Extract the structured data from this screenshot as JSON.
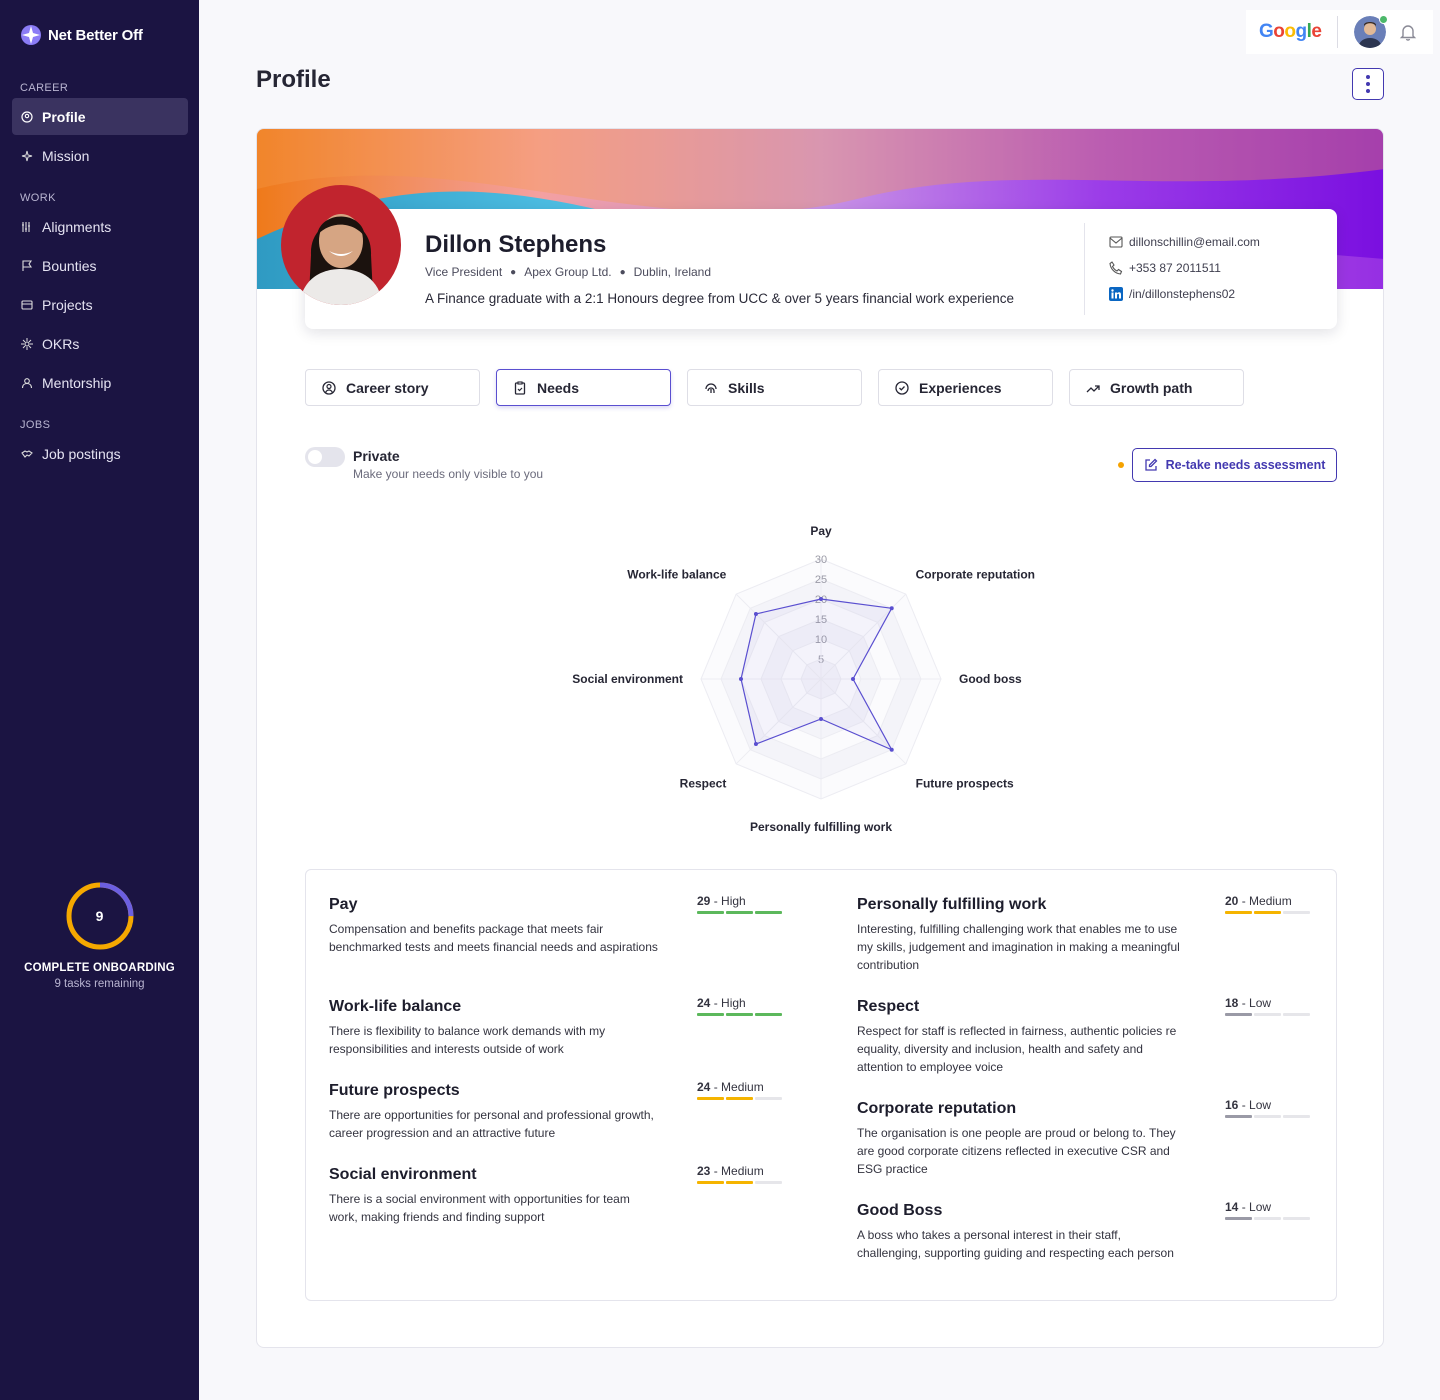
{
  "brand": {
    "name": "Net Better Off"
  },
  "sidebar": {
    "sections": [
      {
        "label": "CAREER",
        "items": [
          {
            "label": "Profile",
            "icon": "profile-icon",
            "active": true
          },
          {
            "label": "Mission",
            "icon": "mission-icon"
          }
        ]
      },
      {
        "label": "WORK",
        "items": [
          {
            "label": "Alignments",
            "icon": "alignments-icon"
          },
          {
            "label": "Bounties",
            "icon": "flag-icon"
          },
          {
            "label": "Projects",
            "icon": "projects-icon"
          },
          {
            "label": "OKRs",
            "icon": "okrs-icon"
          },
          {
            "label": "Mentorship",
            "icon": "mentorship-icon"
          }
        ]
      },
      {
        "label": "JOBS",
        "items": [
          {
            "label": "Job postings",
            "icon": "handshake-icon"
          }
        ]
      }
    ],
    "onboarding": {
      "count": "9",
      "title": "COMPLETE ONBOARDING",
      "subtitle": "9 tasks remaining",
      "progress": 0.75
    }
  },
  "topbar": {
    "google_label": "Google"
  },
  "page": {
    "title": "Profile"
  },
  "profile": {
    "name": "Dillon Stephens",
    "role": "Vice President",
    "company": "Apex Group Ltd.",
    "location": "Dublin, Ireland",
    "bio": "A Finance graduate with a 2:1 Honours degree from UCC & over 5 years financial work experience",
    "email": "dillonschillin@email.com",
    "phone": "+353 87 2011511",
    "linkedin": "/in/dillonstephens02"
  },
  "tabs": [
    "Career story",
    "Needs",
    "Skills",
    "Experiences",
    "Growth path"
  ],
  "privacy": {
    "title": "Private",
    "subtitle": "Make your needs only visible to you",
    "enabled": false
  },
  "retake_label": "Re-take needs assessment",
  "chart_data": {
    "type": "radar",
    "axes": [
      "Pay",
      "Corporate reputation",
      "Good boss",
      "Future prospects",
      "Personally fulfilling work",
      "Respect",
      "Social environment",
      "Work-life balance"
    ],
    "values": [
      20,
      25,
      8,
      25,
      10,
      23,
      20,
      23
    ],
    "rings": [
      5,
      10,
      15,
      20,
      25,
      30
    ],
    "max": 30
  },
  "needs": [
    {
      "title": "Pay",
      "desc": "Compensation and benefits package that meets fair benchmarked tests and meets financial needs and aspirations",
      "score": "29",
      "level": "High",
      "filled": 3,
      "color": "#5cb85c"
    },
    {
      "title": "Work-life balance",
      "desc": "There is flexibility to balance work demands with my responsibilities and interests outside of work",
      "score": "24",
      "level": "High",
      "filled": 3,
      "color": "#5cb85c"
    },
    {
      "title": "Future prospects",
      "desc": "There are opportunities for personal and professional growth, career progression and an attractive future",
      "score": "24",
      "level": "Medium",
      "filled": 2,
      "color": "#f5b400"
    },
    {
      "title": "Social environment",
      "desc": "There is a social environment with opportunities for team work, making friends and finding support",
      "score": "23",
      "level": "Medium",
      "filled": 2,
      "color": "#f5b400"
    },
    {
      "title": "Personally fulfilling work",
      "desc": "Interesting, fulfilling challenging work that enables me to use my skills, judgement and imagination in making a meaningful contribution",
      "score": "20",
      "level": "Medium",
      "filled": 2,
      "color": "#f5b400"
    },
    {
      "title": "Respect",
      "desc": "Respect for staff is reflected in fairness, authentic policies re equality, diversity and inclusion, health and safety and attention to employee voice",
      "score": "18",
      "level": "Low",
      "filled": 1,
      "color": "#9a9aa6"
    },
    {
      "title": "Corporate reputation",
      "desc": "The organisation is one people are proud or belong to. They are good corporate citizens reflected in executive CSR and ESG practice",
      "score": "16",
      "level": "Low",
      "filled": 1,
      "color": "#9a9aa6"
    },
    {
      "title": "Good Boss",
      "desc": "A boss who takes a personal interest in their staff, challenging, supporting guiding and respecting each person",
      "score": "14",
      "level": "Low",
      "filled": 1,
      "color": "#9a9aa6"
    }
  ]
}
